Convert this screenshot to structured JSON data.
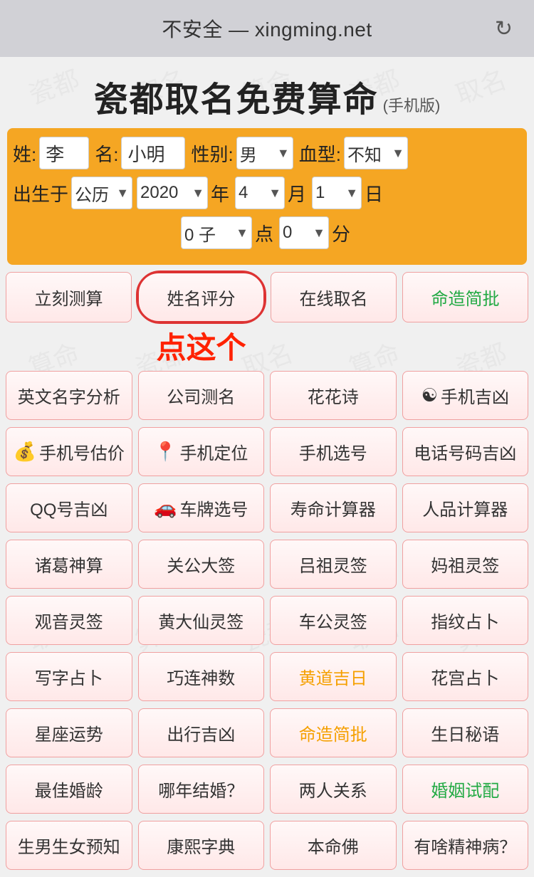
{
  "browser": {
    "url": "不安全 — xingming.net",
    "reload_icon": "↻"
  },
  "page": {
    "title_main": "瓷都取名免费算命",
    "title_sub": "(手机版)"
  },
  "form": {
    "surname_label": "姓:",
    "surname_value": "李",
    "name_label": "名:",
    "name_value": "小明",
    "gender_label": "性别:",
    "gender_value": "男",
    "blood_label": "血型:",
    "blood_value": "不知",
    "birth_label": "出生于",
    "calendar_value": "公历",
    "year_value": "2020",
    "year_label": "年",
    "month_value": "4",
    "month_label": "月",
    "day_value": "1",
    "day_label": "日",
    "hour_value": "0 子",
    "hour_label": "点",
    "minute_value": "0",
    "minute_label": "分"
  },
  "buttons": [
    [
      "立刻测算",
      "姓名评分",
      "在线取名",
      "命造简批"
    ],
    [
      "英文名字分析",
      "公司测名",
      "花花诗",
      "手机吉凶"
    ],
    [
      "手机号估价",
      "手机定位",
      "手机选号",
      "电话号码吉凶"
    ],
    [
      "QQ号吉凶",
      "车牌选号",
      "寿命计算器",
      "人品计算器"
    ],
    [
      "诸葛神算",
      "关公大签",
      "吕祖灵签",
      "妈祖灵签"
    ],
    [
      "观音灵签",
      "黄大仙灵签",
      "车公灵签",
      "指纹占卜"
    ],
    [
      "写字占卜",
      "巧连神数",
      "黄道吉日",
      "花宫占卜"
    ],
    [
      "星座运势",
      "出行吉凶",
      "命造简批",
      "生日秘语"
    ],
    [
      "最佳婚龄",
      "哪年结婚？",
      "两人关系",
      "婚姻试配"
    ],
    [
      "生男生女预知",
      "康熙字典",
      "本命佛",
      "有啥精神病？"
    ]
  ],
  "button_styles": {
    "0_0": "normal",
    "0_1": "highlighted",
    "0_2": "normal",
    "0_3": "green",
    "1_0": "normal",
    "1_1": "normal",
    "1_2": "normal",
    "1_3": "yin-yang",
    "2_0": "money",
    "2_1": "pin",
    "2_2": "normal",
    "2_3": "normal",
    "3_0": "normal",
    "3_1": "car",
    "3_2": "normal",
    "3_3": "normal",
    "6_2": "orange",
    "7_2": "orange",
    "9_3": "normal"
  },
  "annotation": {
    "text": "点这个",
    "arrow": "↑"
  }
}
